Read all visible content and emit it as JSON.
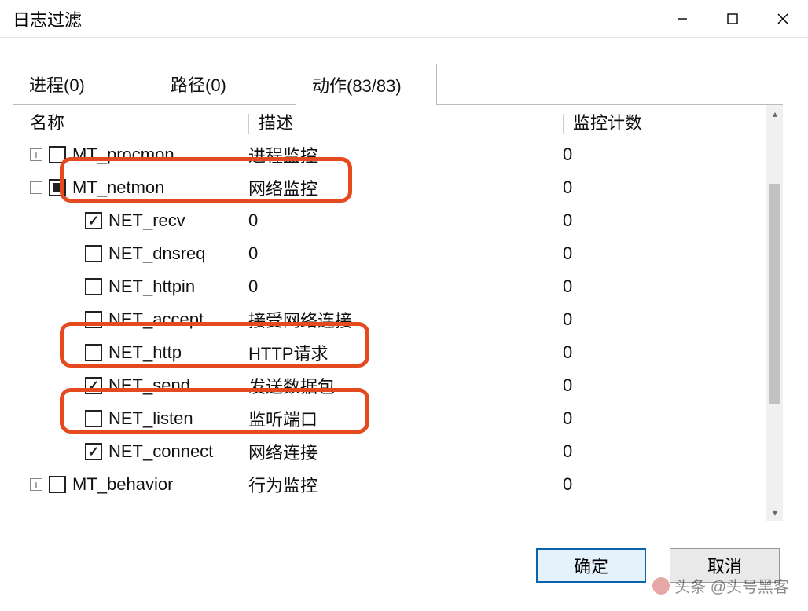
{
  "window": {
    "title": "日志过滤"
  },
  "tabs": [
    {
      "label": "进程(0)",
      "active": false
    },
    {
      "label": "路径(0)",
      "active": false
    },
    {
      "label": "动作(83/83)",
      "active": true
    }
  ],
  "columns": {
    "name": "名称",
    "desc": "描述",
    "count": "监控计数"
  },
  "rows": [
    {
      "level": 0,
      "expander": "plus",
      "check": "none",
      "name": "MT_procmon",
      "desc": "进程监控",
      "count": "0",
      "highlight": false
    },
    {
      "level": 0,
      "expander": "minus",
      "check": "partial",
      "name": "MT_netmon",
      "desc": "网络监控",
      "count": "0",
      "highlight": false
    },
    {
      "level": 1,
      "expander": "",
      "check": "checked",
      "name": "NET_recv",
      "desc": "0",
      "count": "0",
      "highlight": true
    },
    {
      "level": 1,
      "expander": "",
      "check": "none",
      "name": "NET_dnsreq",
      "desc": "0",
      "count": "0",
      "highlight": false
    },
    {
      "level": 1,
      "expander": "",
      "check": "none",
      "name": "NET_httpin",
      "desc": "0",
      "count": "0",
      "highlight": false
    },
    {
      "level": 1,
      "expander": "",
      "check": "none",
      "name": "NET_accept",
      "desc": "接受网络连接",
      "count": "0",
      "highlight": false
    },
    {
      "level": 1,
      "expander": "",
      "check": "none",
      "name": "NET_http",
      "desc": "HTTP请求",
      "count": "0",
      "highlight": false
    },
    {
      "level": 1,
      "expander": "",
      "check": "checked",
      "name": "NET_send",
      "desc": "发送数据包",
      "count": "0",
      "highlight": true
    },
    {
      "level": 1,
      "expander": "",
      "check": "none",
      "name": "NET_listen",
      "desc": "监听端口",
      "count": "0",
      "highlight": false
    },
    {
      "level": 1,
      "expander": "",
      "check": "checked",
      "name": "NET_connect",
      "desc": "网络连接",
      "count": "0",
      "highlight": true
    },
    {
      "level": 0,
      "expander": "plus",
      "check": "none",
      "name": "MT_behavior",
      "desc": "行为监控",
      "count": "0",
      "highlight": false
    }
  ],
  "buttons": {
    "ok": "确定",
    "cancel": "取消"
  },
  "watermark": "头条 @头号黑客"
}
